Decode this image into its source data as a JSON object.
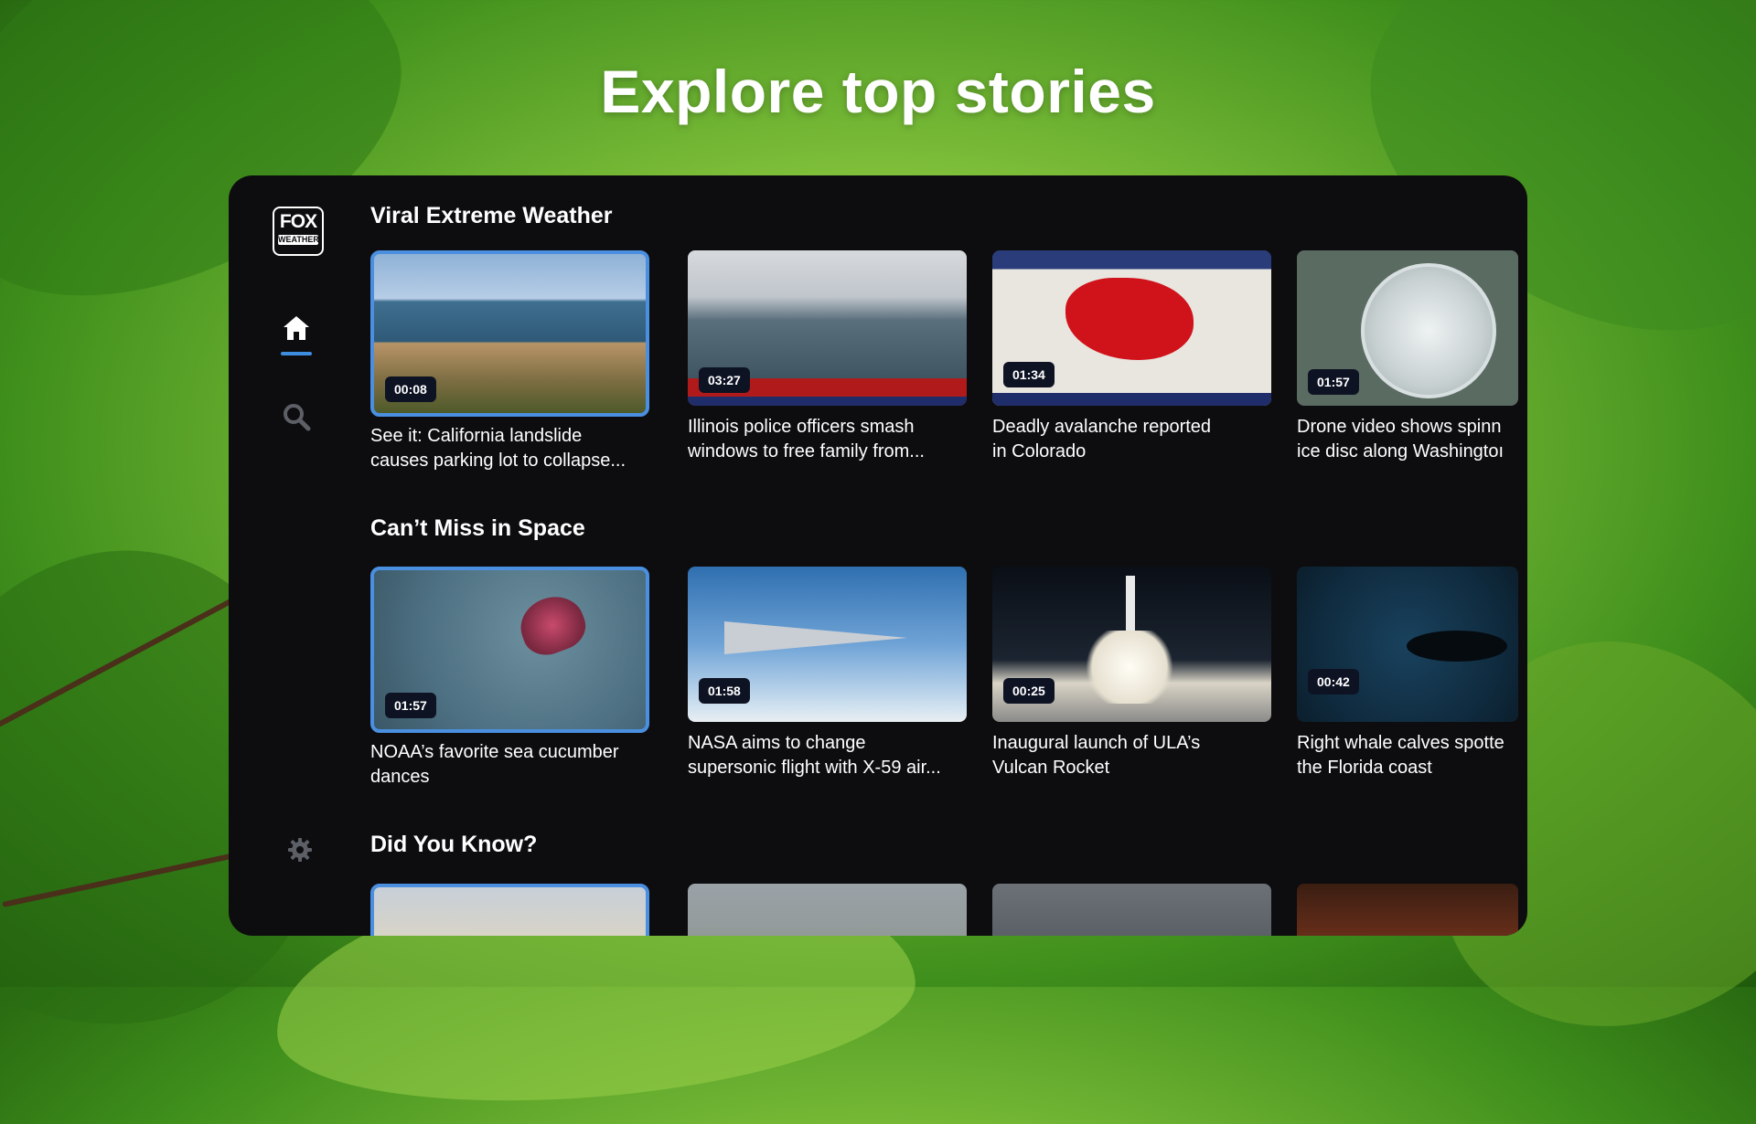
{
  "headline": "Explore top stories",
  "nav": {
    "logo_top": "FOX",
    "logo_bottom": "WEATHER",
    "items": [
      {
        "name": "home",
        "icon": "home-icon",
        "active": true
      },
      {
        "name": "search",
        "icon": "search-icon",
        "active": false
      },
      {
        "name": "settings",
        "icon": "gear-icon",
        "active": false
      }
    ]
  },
  "rows": [
    {
      "title": "Viral Extreme Weather",
      "cards": [
        {
          "duration": "00:08",
          "caption_line1": "See it: California landslide",
          "caption_line2": "causes parking lot to collapse...",
          "focused": true
        },
        {
          "duration": "03:27",
          "caption_line1": "Illinois police officers smash",
          "caption_line2": "windows to free family from...",
          "focused": false
        },
        {
          "duration": "01:34",
          "caption_line1": "Deadly avalanche reported",
          "caption_line2": "in Colorado",
          "focused": false
        },
        {
          "duration": "01:57",
          "caption_line1": "Drone video shows spinn",
          "caption_line2": "ice disc along Washingtoı",
          "focused": false
        }
      ]
    },
    {
      "title": "Can’t Miss in Space",
      "cards": [
        {
          "duration": "01:57",
          "caption_line1": "NOAA’s favorite sea cucumber",
          "caption_line2": "dances",
          "focused": true
        },
        {
          "duration": "01:58",
          "caption_line1": "NASA aims to change",
          "caption_line2": "supersonic flight with X-59 air...",
          "focused": false
        },
        {
          "duration": "00:25",
          "caption_line1": "Inaugural launch of ULA’s",
          "caption_line2": "Vulcan Rocket",
          "focused": false
        },
        {
          "duration": "00:42",
          "caption_line1": "Right whale calves spotte",
          "caption_line2": "the Florida coast",
          "focused": false
        }
      ]
    },
    {
      "title": "Did You Know?",
      "cards": [
        {
          "focused": true
        },
        {
          "focused": false
        },
        {
          "focused": false
        },
        {
          "focused": false
        }
      ]
    }
  ],
  "colors": {
    "accent": "#4a8fe0",
    "panel": "#0d0d0f",
    "badge": "#0e1324"
  }
}
